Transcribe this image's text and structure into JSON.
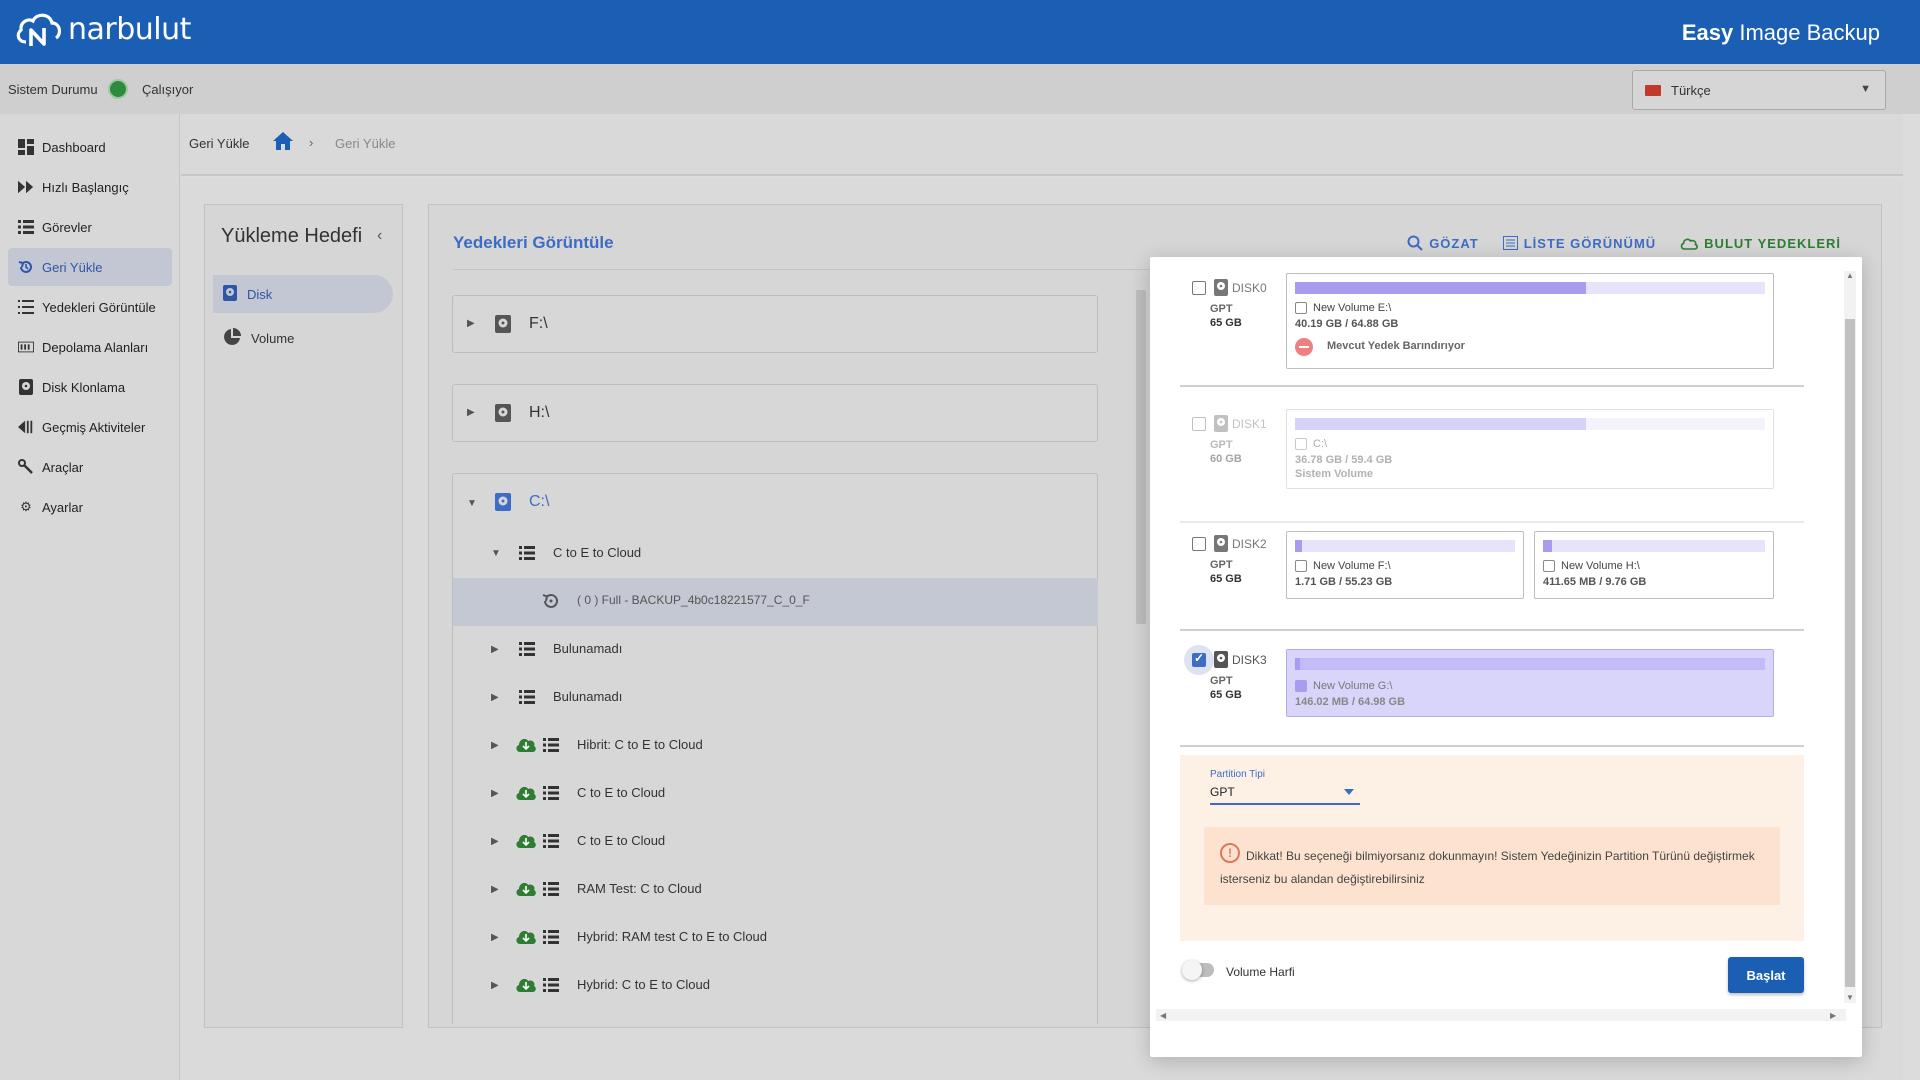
{
  "header": {
    "brand": "narbulut",
    "app_title_bold": "Easy",
    "app_title_rest": " Image Backup"
  },
  "status": {
    "label": "Sistem Durumu",
    "value": "Çalışıyor",
    "color": "#2e8b3e"
  },
  "language": {
    "selected": "Türkçe"
  },
  "sidebar": {
    "items": [
      {
        "label": "Dashboard",
        "icon": "dashboard-icon"
      },
      {
        "label": "Hızlı Başlangıç",
        "icon": "fast-forward-icon"
      },
      {
        "label": "Görevler",
        "icon": "list-icon"
      },
      {
        "label": "Geri Yükle",
        "icon": "restore-icon",
        "active": true
      },
      {
        "label": "Yedekleri Görüntüle",
        "icon": "view-list-icon"
      },
      {
        "label": "Depolama Alanları",
        "icon": "storage-icon"
      },
      {
        "label": "Disk Klonlama",
        "icon": "disk-icon"
      },
      {
        "label": "Geçmiş Aktiviteler",
        "icon": "history-icon"
      },
      {
        "label": "Araçlar",
        "icon": "tools-icon"
      },
      {
        "label": "Ayarlar",
        "icon": "gear-icon"
      }
    ]
  },
  "breadcrumb": {
    "title": "Geri Yükle",
    "separator": "›",
    "current": "Geri Yükle"
  },
  "target_panel": {
    "title": "Yükleme Hedefi",
    "items": [
      {
        "label": "Disk",
        "active": true
      },
      {
        "label": "Volume"
      }
    ]
  },
  "main": {
    "title": "Yedekleri Görüntüle",
    "actions": {
      "browse": "GÖZAT",
      "list_view": "LİSTE GÖRÜNÜMÜ",
      "cloud_backups": "BULUT YEDEKLERİ"
    },
    "tree": {
      "drives": [
        "F:\\",
        "H:\\",
        "C:\\"
      ],
      "group": "C to E to Cloud",
      "selected_backup": "( 0 ) Full - BACKUP_4b0c18221577_C_0_F",
      "rows": [
        {
          "label": "Bulunamadı",
          "cloud": false
        },
        {
          "label": "Bulunamadı",
          "cloud": false
        },
        {
          "label": "Hibrit: C to E to Cloud",
          "cloud": true
        },
        {
          "label": "C to E to Cloud",
          "cloud": true
        },
        {
          "label": "C to E to Cloud",
          "cloud": true
        },
        {
          "label": "RAM Test: C to Cloud",
          "cloud": true
        },
        {
          "label": "Hybrid: RAM test C to E to Cloud",
          "cloud": true
        },
        {
          "label": "Hybrid: C to E to Cloud",
          "cloud": true
        }
      ]
    }
  },
  "modal": {
    "disks": [
      {
        "name": "DISK0",
        "type": "GPT",
        "size": "65 GB",
        "checked": false,
        "disabled": false,
        "partitions": [
          {
            "name": "New Volume E:\\",
            "size": "40.19 GB / 64.88 GB",
            "fill": 0.62,
            "checked": false,
            "note": "Mevcut Yedek Barındırıyor"
          }
        ]
      },
      {
        "name": "DISK1",
        "type": "GPT",
        "size": "60 GB",
        "checked": false,
        "disabled": true,
        "partitions": [
          {
            "name": "C:\\",
            "size": "36.78 GB / 59.4 GB",
            "fill": 0.62,
            "checked": false,
            "note": "Sistem Volume"
          }
        ]
      },
      {
        "name": "DISK2",
        "type": "GPT",
        "size": "65 GB",
        "checked": false,
        "disabled": false,
        "partitions": [
          {
            "name": "New Volume F:\\",
            "size": "1.71 GB / 55.23 GB",
            "fill": 0.03,
            "checked": false
          },
          {
            "name": "New Volume H:\\",
            "size": "411.65 MB / 9.76 GB",
            "fill": 0.04,
            "checked": false
          }
        ]
      },
      {
        "name": "DISK3",
        "type": "GPT",
        "size": "65 GB",
        "checked": true,
        "disabled": false,
        "partitions": [
          {
            "name": "New Volume G:\\",
            "size": "146.02 MB / 64.98 GB",
            "fill": 0.002,
            "checked": true
          }
        ]
      }
    ],
    "partition_type": {
      "label": "Partition Tipi",
      "value": "GPT"
    },
    "warning": "Dikkat! Bu seçeneği bilmiyorsanız dokunmayın! Sistem Yedeğinizin Partition Türünü değiştirmek isterseniz bu alandan değiştirebilirsiniz",
    "volume_letter_label": "Volume Harfi",
    "volume_letter_on": false,
    "start_button": "Başlat"
  },
  "colors": {
    "brand": "#1a5fb4",
    "accent": "#3d6cc4",
    "cloud_green": "#2e7d32",
    "partition_fill": "#a79cf0"
  }
}
